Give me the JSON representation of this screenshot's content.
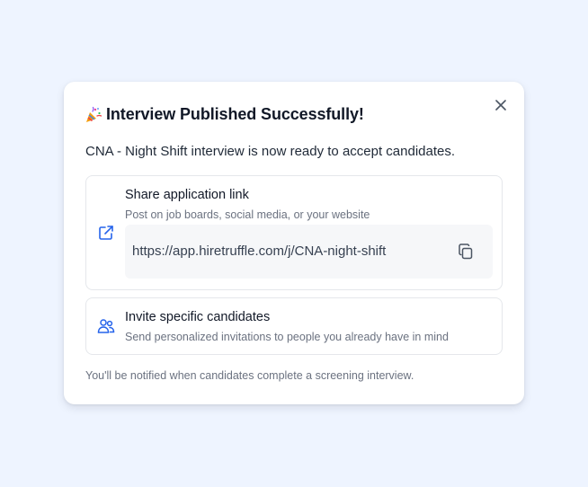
{
  "modal": {
    "title": "Interview Published Successfully!",
    "title_emoji_icon": "party-popper-icon",
    "subtitle": "CNA - Night Shift interview is now ready to accept candidates.",
    "close_icon": "close-icon",
    "footer": "You'll be notified when candidates complete a screening interview."
  },
  "share": {
    "icon": "external-link-icon",
    "title": "Share application link",
    "description": "Post on job boards, social media, or your website",
    "url": "https://app.hiretruffle.com/j/CNA-night-shift",
    "copy_icon": "copy-icon"
  },
  "invite": {
    "icon": "users-icon",
    "title": "Invite specific candidates",
    "description": "Send personalized invitations to people you already have in mind"
  },
  "colors": {
    "background": "#eef4ff",
    "accent": "#2563eb",
    "text_primary": "#111827",
    "text_secondary": "#6b7280",
    "border": "#e5e7eb"
  }
}
